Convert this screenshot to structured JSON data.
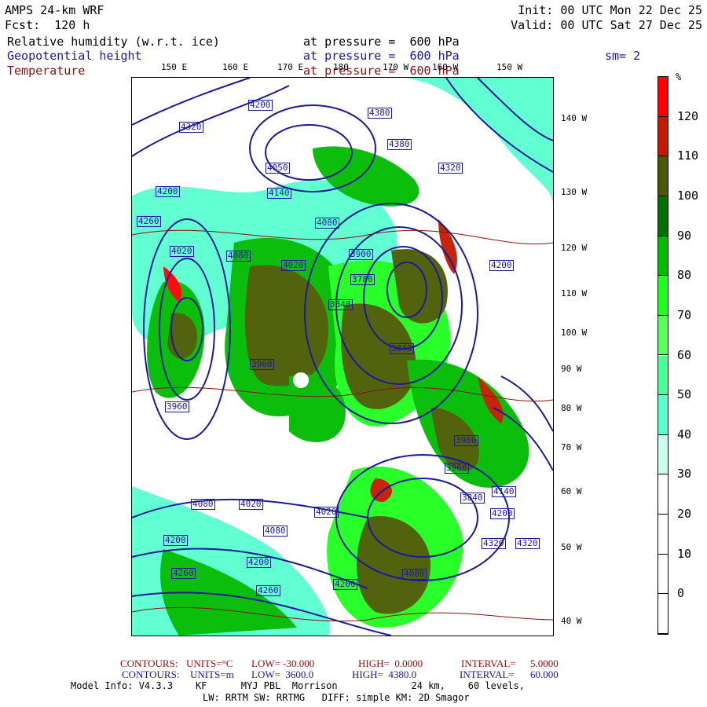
{
  "header": {
    "model": "AMPS 24-km WRF",
    "forecast": "Fcst:  120 h",
    "init": "Init: 00 UTC Mon 22 Dec 25",
    "valid": "Valid: 00 UTC Sat 27 Dec 25",
    "fields": [
      {
        "name": "Relative humidity (w.r.t. ice)",
        "level": "at pressure =  600 hPa"
      },
      {
        "name": "Geopotential height",
        "level": "at pressure =  600 hPa"
      },
      {
        "name": "Temperature",
        "level": "at pressure =  600 hPa"
      }
    ],
    "smoothing": "sm= 2"
  },
  "map": {
    "top_lon_labels": [
      "150 E",
      "160 E",
      "170 E",
      "180",
      "170 W",
      "160 W",
      "150 W"
    ],
    "right_labels": [
      "140 W",
      "130 W",
      "120 W",
      "110 W",
      "100 W",
      "90 W",
      "80 W",
      "70 W",
      "60 W",
      "50 W",
      "40 W"
    ],
    "height_contour_labels": [
      "4200",
      "4320",
      "4380",
      "4380",
      "4320",
      "4260",
      "4200",
      "4140",
      "4080",
      "4050",
      "4020",
      "4080",
      "4020",
      "3900",
      "3960",
      "3840",
      "3780",
      "3840",
      "3960",
      "4080",
      "4020",
      "4020",
      "4080",
      "4200",
      "4260",
      "4200",
      "4260",
      "4200",
      "4320",
      "4200",
      "4140",
      "4080",
      "3960",
      "3900",
      "3840",
      "4200",
      "4320"
    ]
  },
  "colorbar": {
    "unit": "%",
    "labels": [
      "120",
      "110",
      "100",
      "90",
      "80",
      "70",
      "60",
      "50",
      "40",
      "30",
      "20",
      "10",
      "0"
    ],
    "colors": [
      "#ff0000",
      "#c41a00",
      "#4a5a00",
      "#007000",
      "#00bb00",
      "#1eff1e",
      "#5aff5a",
      "#4aff9a",
      "#5affd0",
      "#c8ffee",
      "#ffffff",
      "#ffffff",
      "#ffffff",
      "#ffffff"
    ]
  },
  "footer": {
    "temp_contours": {
      "label": "CONTOURS:",
      "units": "UNITS=°C",
      "low": "LOW= -30.000",
      "high": "HIGH=  0.0000",
      "interval": "INTERVAL=",
      "interval_value": "5.0000"
    },
    "height_contours": {
      "label": "CONTOURS:",
      "units": "UNITS=m",
      "low": "LOW=  3600.0",
      "high": "HIGH=  4380.0",
      "interval": "INTERVAL=",
      "interval_value": "60.000"
    },
    "model_info": "Model Info: V4.3.3    KF      MYJ PBL  Morrison             24 km,    60 levels,",
    "physics": "LW: RRTM SW: RRTMG   DIFF: simple KM: 2D Smagor"
  }
}
